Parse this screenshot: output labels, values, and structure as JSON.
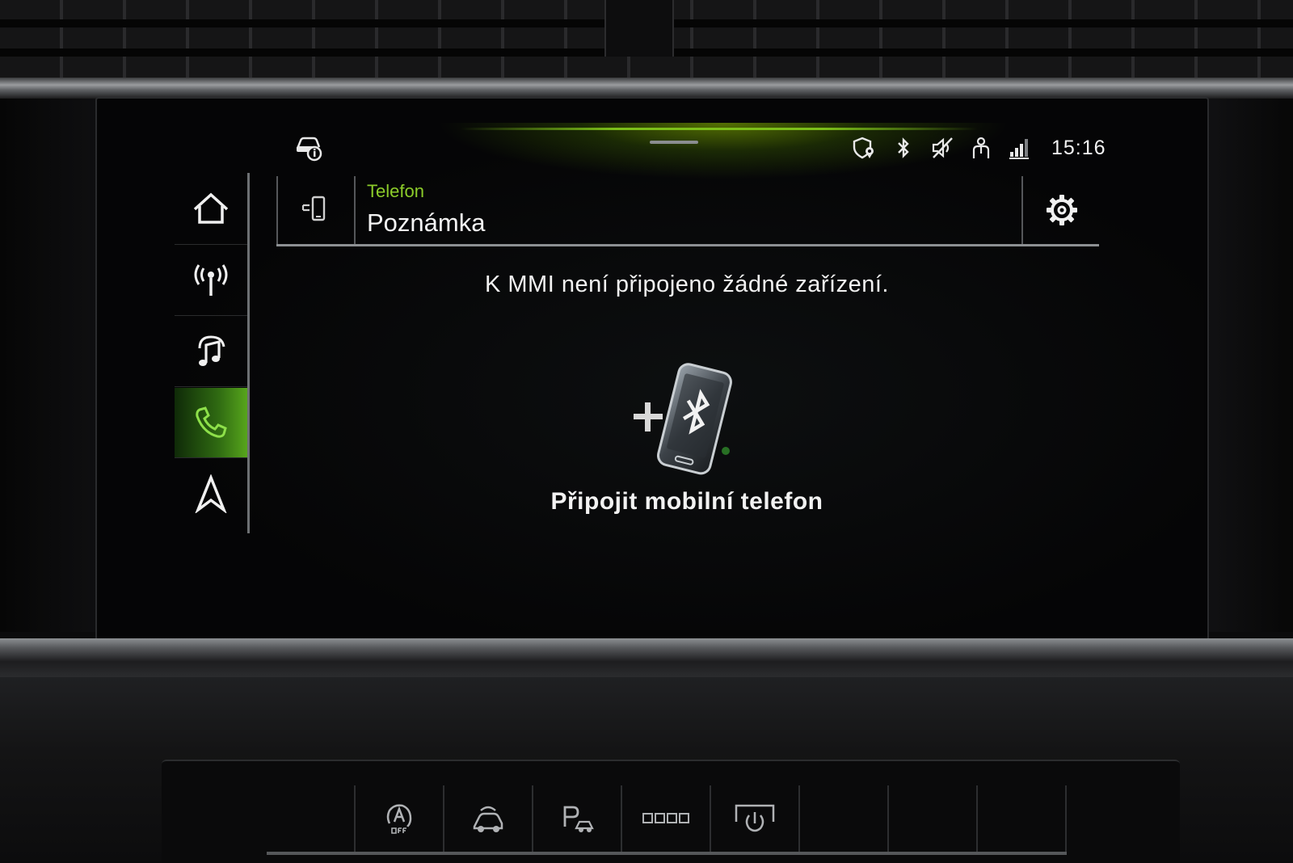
{
  "status_bar": {
    "time": "15:16",
    "left_icon": "car-info-icon",
    "icons": [
      "location-shield-icon",
      "bluetooth-icon",
      "speaker-muted-icon",
      "passenger-icon",
      "signal-4g-icon"
    ]
  },
  "sidebar": {
    "items": [
      {
        "icon": "home-icon",
        "active": false
      },
      {
        "icon": "radio-icon",
        "active": false
      },
      {
        "icon": "media-icon",
        "active": false
      },
      {
        "icon": "phone-icon",
        "active": true
      },
      {
        "icon": "navigation-icon",
        "active": false
      }
    ]
  },
  "header": {
    "subtitle": "Telefon",
    "title": "Poznámka",
    "device_icon": "phone-device-icon",
    "settings_icon": "gear-icon"
  },
  "main": {
    "message": "K MMI není připojeno žádné zařízení.",
    "connect_label": "Připojit mobilní telefon",
    "connect_icon": "bluetooth-phone-icon"
  },
  "colors": {
    "accent": "#8ccc2a",
    "active_nav": "#57a51c",
    "text": "#f2f2f2"
  }
}
